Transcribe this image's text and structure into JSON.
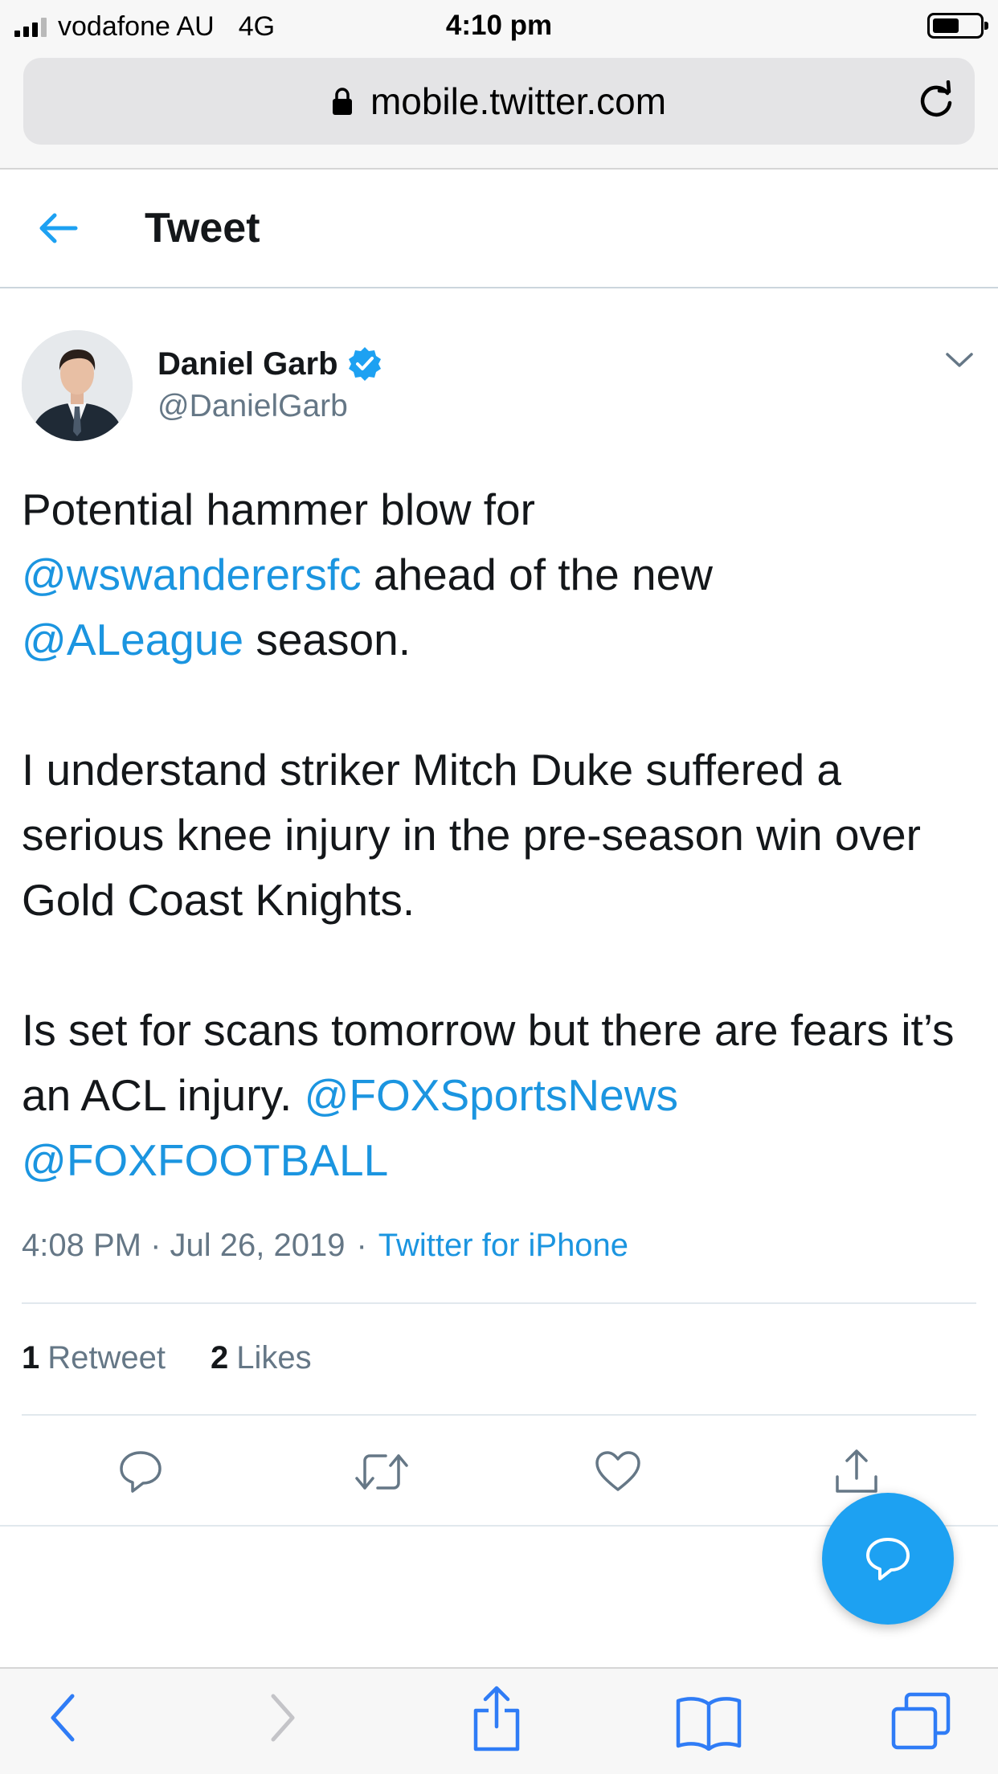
{
  "status_bar": {
    "carrier": "vodafone AU",
    "network": "4G",
    "time": "4:10 pm",
    "signal_bars_active": 3,
    "signal_bars_total": 4,
    "battery_level": 0.55
  },
  "browser": {
    "url": "mobile.twitter.com",
    "icons": [
      "lock-icon",
      "reload-icon"
    ]
  },
  "header": {
    "title": "Tweet",
    "back_icon": "arrow-left-icon"
  },
  "tweet": {
    "author_name": "Daniel Garb",
    "author_handle": "@DanielGarb",
    "verified": true,
    "body": {
      "p1_a": "Potential hammer blow for",
      "p1_mention1": "@wswanderersfc",
      "p1_b": " ahead of the new",
      "p1_mention2": "@ALeague",
      "p1_c": " season.",
      "p2": "I understand striker Mitch Duke suffered a serious knee injury in the pre-season win over Gold Coast Knights.",
      "p3_a": "Is set for scans tomorrow but there are fears it’s an ACL injury. ",
      "p3_mention1": "@FOXSportsNews",
      "p3_mention2": "@FOXFOOTBALL"
    },
    "timestamp": "4:08 PM · Jul 26, 2019",
    "separator": "·",
    "source": "Twitter for iPhone",
    "retweet_count": "1",
    "retweet_label": "Retweet",
    "like_count": "2",
    "like_label": "Likes"
  },
  "actions": [
    "reply-icon",
    "retweet-icon",
    "like-icon",
    "share-icon"
  ],
  "fab": {
    "icon": "compose-reply-icon"
  },
  "colors": {
    "accent": "#1da1f2",
    "link": "#1b95e0",
    "text": "#14171a",
    "secondary": "#657786",
    "ios_blue": "#2f7cf6"
  },
  "bottom_toolbar": [
    "back-icon",
    "forward-icon",
    "share-icon",
    "bookmarks-icon",
    "tabs-icon"
  ]
}
